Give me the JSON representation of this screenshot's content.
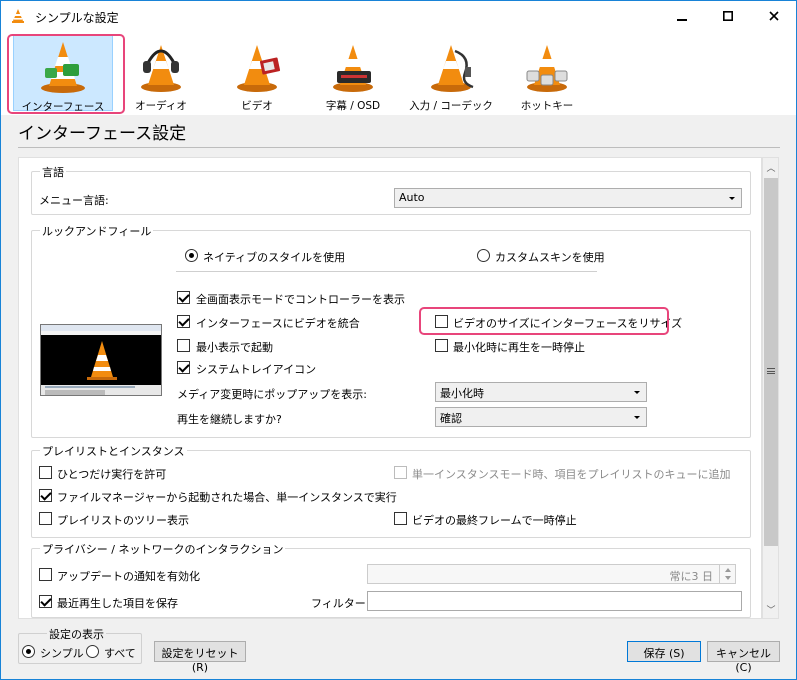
{
  "window": {
    "title": "シンプルな設定"
  },
  "toolbar": {
    "items": [
      {
        "label": "インターフェース",
        "icon": "vlc-cone-icon"
      },
      {
        "label": "オーディオ",
        "icon": "headphones-cone-icon"
      },
      {
        "label": "ビデオ",
        "icon": "film-cone-icon"
      },
      {
        "label": "字幕 / OSD",
        "icon": "subtitle-cone-icon"
      },
      {
        "label": "入力 / コーデック",
        "icon": "cable-cone-icon"
      },
      {
        "label": "ホットキー",
        "icon": "keyboard-cone-icon"
      }
    ]
  },
  "section_title": "インターフェース設定",
  "language": {
    "group_title": "言語",
    "menu_language_label": "メニュー言語:",
    "menu_language_value": "Auto"
  },
  "look": {
    "group_title": "ルックアンドフィール",
    "style_native": "ネイティブのスタイルを使用",
    "style_custom": "カスタムスキンを使用",
    "fullscreen_controller": "全画面表示モードでコントローラーを表示",
    "integrate_video": "インターフェースにビデオを統合",
    "resize_interface": "ビデオのサイズにインターフェースをリサイズ",
    "start_minimized": "最小表示で起動",
    "pause_minimized": "最小化時に再生を一時停止",
    "systray": "システムトレイアイコン",
    "popup_label": "メディア変更時にポップアップを表示:",
    "popup_value": "最小化時",
    "resume_label": "再生を継続しますか?",
    "resume_value": "確認"
  },
  "playlist": {
    "group_title": "プレイリストとインスタンス",
    "one_instance": "ひとつだけ実行を許可",
    "enqueue_single": "単一インスタンスモード時、項目をプレイリストのキューに追加",
    "file_manager_single": "ファイルマネージャーから起動された場合、単一インスタンスで実行",
    "tree_view": "プレイリストのツリー表示",
    "pause_last_frame": "ビデオの最終フレームで一時停止"
  },
  "privacy": {
    "group_title": "プライバシー / ネットワークのインタラクション",
    "update_notify": "アップデートの通知を有効化",
    "update_interval": "常に3 日",
    "save_recent": "最近再生した項目を保存",
    "filter_label": "フィルター:",
    "filter_value": ""
  },
  "view": {
    "group_title": "設定の表示",
    "simple": "シンプル",
    "all": "すべて"
  },
  "buttons": {
    "reset": "設定をリセット (R)",
    "save": "保存 (S)",
    "cancel": "キャンセル (C)"
  },
  "colors": {
    "accent": "#0078d7",
    "highlight": "#e8457b",
    "selection": "#cce8ff",
    "cone_orange": "#f28c0f"
  }
}
